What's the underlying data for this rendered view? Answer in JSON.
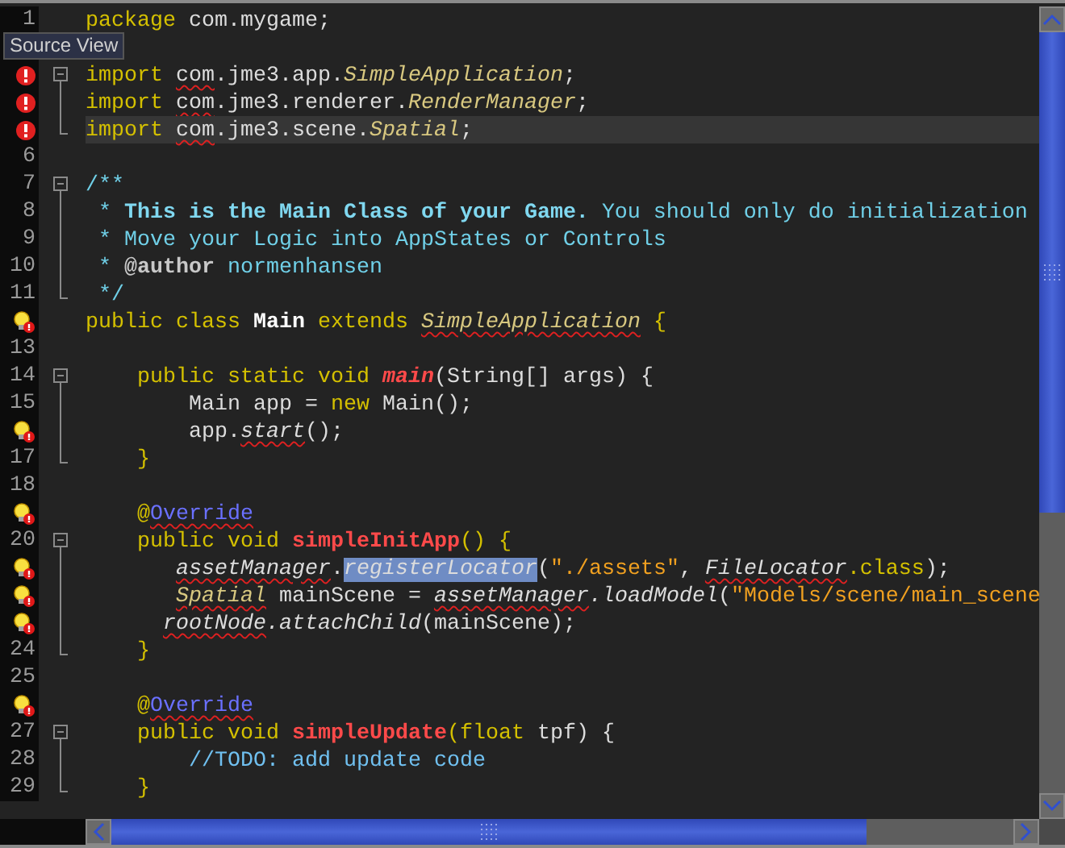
{
  "tooltip": "Source View",
  "lines": [
    {
      "number": "1",
      "current": false,
      "code": [
        {
          "t": "package",
          "kind": "keyword"
        },
        {
          "t": " com.mygame;",
          "kind": "plain"
        }
      ]
    },
    {
      "current": false
    },
    {
      "marker": {
        "kind": "error"
      },
      "fold": {
        "kind": "start"
      },
      "current": false,
      "code": [
        {
          "t": "import ",
          "kind": "keyword"
        },
        {
          "t": "com",
          "kind": "plain",
          "err": true
        },
        {
          "t": ".jme3.app.",
          "kind": "plain"
        },
        {
          "t": "SimpleApplication",
          "kind": "type"
        },
        {
          "t": ";",
          "kind": "plain"
        }
      ]
    },
    {
      "marker": {
        "kind": "error"
      },
      "fold": {
        "kind": "line"
      },
      "current": false,
      "code": [
        {
          "t": "import ",
          "kind": "keyword"
        },
        {
          "t": "com",
          "kind": "plain",
          "err": true
        },
        {
          "t": ".jme3.renderer.",
          "kind": "plain"
        },
        {
          "t": "RenderManager",
          "kind": "type"
        },
        {
          "t": ";",
          "kind": "plain"
        }
      ]
    },
    {
      "marker": {
        "kind": "error"
      },
      "fold": {
        "kind": "end"
      },
      "current": true,
      "code": [
        {
          "t": "import ",
          "kind": "keyword"
        },
        {
          "t": "com",
          "kind": "plain",
          "err": true
        },
        {
          "t": ".jme3.scene.",
          "kind": "plain"
        },
        {
          "t": "Spatial",
          "kind": "type"
        },
        {
          "t": ";",
          "kind": "plain"
        }
      ]
    },
    {
      "number": "6",
      "current": false
    },
    {
      "number": "7",
      "fold": {
        "kind": "start"
      },
      "current": false,
      "code": [
        {
          "t": "/**",
          "kind": "comment"
        }
      ]
    },
    {
      "number": "8",
      "fold": {
        "kind": "line"
      },
      "current": false,
      "code": [
        {
          "t": " *",
          "kind": "comment"
        },
        {
          "t": " This is the Main Class of your Game.",
          "kind": "doc-bold"
        },
        {
          "t": " You should only do initialization",
          "kind": "comment"
        }
      ]
    },
    {
      "number": "9",
      "fold": {
        "kind": "line"
      },
      "current": false,
      "code": [
        {
          "t": " * Move your Logic into AppStates or Controls",
          "kind": "comment"
        }
      ]
    },
    {
      "number": "10",
      "fold": {
        "kind": "line"
      },
      "current": false,
      "code": [
        {
          "t": " *",
          "kind": "comment"
        },
        {
          "t": " @author",
          "kind": "doc-tag"
        },
        {
          "t": " normenhansen",
          "kind": "comment"
        }
      ]
    },
    {
      "number": "11",
      "fold": {
        "kind": "end"
      },
      "current": false,
      "code": [
        {
          "t": " */",
          "kind": "comment"
        }
      ]
    },
    {
      "marker": {
        "kind": "hint"
      },
      "current": false,
      "code": [
        {
          "t": "public class ",
          "kind": "keyword"
        },
        {
          "t": "Main",
          "kind": "class-name"
        },
        {
          "t": " extends ",
          "kind": "keyword"
        },
        {
          "t": "SimpleApplication",
          "kind": "type",
          "err": true
        },
        {
          "t": " {",
          "kind": "keyword"
        }
      ]
    },
    {
      "number": "13",
      "current": false
    },
    {
      "number": "14",
      "fold": {
        "kind": "start"
      },
      "current": false,
      "code": [
        {
          "t": "    public static void ",
          "kind": "keyword"
        },
        {
          "t": "main",
          "kind": "method-static"
        },
        {
          "t": "(String[] args) {",
          "kind": "plain"
        }
      ]
    },
    {
      "number": "15",
      "fold": {
        "kind": "line"
      },
      "current": false,
      "code": [
        {
          "t": "        Main app = ",
          "kind": "plain"
        },
        {
          "t": "new",
          "kind": "keyword"
        },
        {
          "t": " Main();",
          "kind": "plain"
        }
      ]
    },
    {
      "marker": {
        "kind": "hint"
      },
      "fold": {
        "kind": "line"
      },
      "current": false,
      "code": [
        {
          "t": "        app.",
          "kind": "plain"
        },
        {
          "t": "start",
          "kind": "field",
          "err": true
        },
        {
          "t": "();",
          "kind": "plain"
        }
      ]
    },
    {
      "number": "17",
      "fold": {
        "kind": "end"
      },
      "current": false,
      "code": [
        {
          "t": "    }",
          "kind": "keyword"
        }
      ]
    },
    {
      "number": "18",
      "current": false
    },
    {
      "marker": {
        "kind": "hint"
      },
      "current": false,
      "code": [
        {
          "t": "    @",
          "kind": "keyword"
        },
        {
          "t": "Override",
          "kind": "annotation",
          "err": true
        }
      ]
    },
    {
      "number": "20",
      "fold": {
        "kind": "start"
      },
      "current": false,
      "code": [
        {
          "t": "    public void ",
          "kind": "keyword"
        },
        {
          "t": "simpleInitApp",
          "kind": "method"
        },
        {
          "t": "() {",
          "kind": "keyword"
        }
      ]
    },
    {
      "marker": {
        "kind": "hint"
      },
      "fold": {
        "kind": "line"
      },
      "current": false,
      "code": [
        {
          "t": "       assetManager",
          "kind": "field",
          "err": true
        },
        {
          "t": ".",
          "kind": "plain"
        },
        {
          "t": "registerLocator",
          "kind": "field",
          "selected": true
        },
        {
          "t": "(",
          "kind": "plain"
        },
        {
          "t": "\"./assets\"",
          "kind": "string"
        },
        {
          "t": ", ",
          "kind": "plain"
        },
        {
          "t": "FileLocator",
          "kind": "field",
          "err": true
        },
        {
          "t": ".class",
          "kind": "keyword"
        },
        {
          "t": ");",
          "kind": "plain"
        }
      ]
    },
    {
      "marker": {
        "kind": "hint"
      },
      "fold": {
        "kind": "line"
      },
      "current": false,
      "code": [
        {
          "t": "       Spatial",
          "kind": "type",
          "err": true
        },
        {
          "t": " mainScene = ",
          "kind": "plain"
        },
        {
          "t": "assetManager",
          "kind": "field",
          "err": true
        },
        {
          "t": ".loadModel",
          "kind": "field"
        },
        {
          "t": "(",
          "kind": "plain"
        },
        {
          "t": "\"Models/scene/main_scene",
          "kind": "string"
        }
      ]
    },
    {
      "marker": {
        "kind": "hint"
      },
      "fold": {
        "kind": "line"
      },
      "current": false,
      "code": [
        {
          "t": "      rootNode",
          "kind": "field",
          "err": true
        },
        {
          "t": ".attachChild",
          "kind": "field"
        },
        {
          "t": "(mainScene);",
          "kind": "plain"
        }
      ]
    },
    {
      "number": "24",
      "fold": {
        "kind": "end"
      },
      "current": false,
      "code": [
        {
          "t": "    }",
          "kind": "keyword"
        }
      ]
    },
    {
      "number": "25",
      "current": false
    },
    {
      "marker": {
        "kind": "hint"
      },
      "current": false,
      "code": [
        {
          "t": "    @",
          "kind": "keyword"
        },
        {
          "t": "Override",
          "kind": "annotation",
          "err": true
        }
      ]
    },
    {
      "number": "27",
      "fold": {
        "kind": "start"
      },
      "current": false,
      "code": [
        {
          "t": "    public void ",
          "kind": "keyword"
        },
        {
          "t": "simpleUpdate",
          "kind": "method"
        },
        {
          "t": "(float",
          "kind": "keyword"
        },
        {
          "t": " tpf) {",
          "kind": "plain"
        }
      ]
    },
    {
      "number": "28",
      "fold": {
        "kind": "line"
      },
      "current": false,
      "code": [
        {
          "t": "        //TODO: add update code",
          "kind": "todo"
        }
      ]
    },
    {
      "number": "29",
      "fold": {
        "kind": "end"
      },
      "current": false,
      "code": [
        {
          "t": "    }",
          "kind": "keyword"
        }
      ]
    }
  ]
}
